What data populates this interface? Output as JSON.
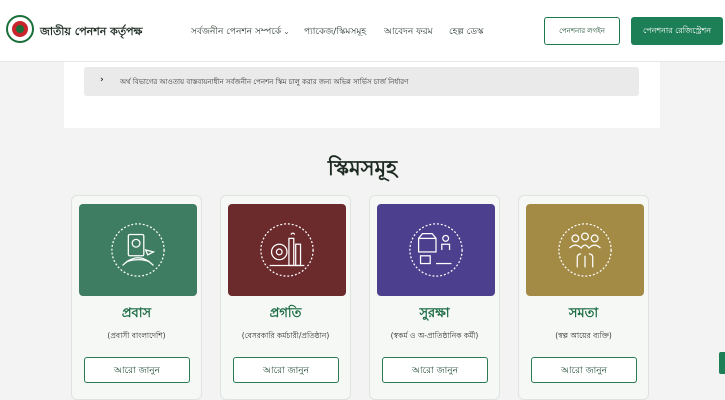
{
  "header": {
    "logo_icon": "government-seal-icon",
    "brand": "জাতীয় পেনশন কর্তৃপক্ষ",
    "nav": [
      {
        "label": "সর্বজনীন পেনশন সম্পর্কে",
        "dropdown": true
      },
      {
        "label": "প্যাকেজ/স্কিমসমূহ",
        "dropdown": false
      },
      {
        "label": "আবেদন ফরম",
        "dropdown": false
      },
      {
        "label": "হেল্প ডেস্ক",
        "dropdown": false
      }
    ],
    "chevron": "⌄",
    "login_label": "পেনশনার লগইন",
    "register_label": "পেনশনার রেজিস্ট্রেশন"
  },
  "notice": {
    "arrow": "›",
    "text": "অর্থ বিভাগের আওতায় বাস্তবায়নাধীন সর্বজনীন পেনশন স্কিম চালু করার জন্য অভিন্ন সার্ভিস চার্জ নির্ধারণ"
  },
  "schemes": {
    "title": "স্কিমসমূহ",
    "cards": [
      {
        "title": "প্রবাস",
        "subtitle": "(প্রবাসী বাংলাদেশি)",
        "button": "আরো জানুন",
        "color": "#3f7d62",
        "icon": "passport-globe-icon"
      },
      {
        "title": "প্রগতি",
        "subtitle": "(বেসরকারি কর্মচারী/প্রতিষ্ঠান)",
        "button": "আরো জানুন",
        "color": "#6b2a2c",
        "icon": "industry-gear-icon"
      },
      {
        "title": "সুরক্ষা",
        "subtitle": "(স্বকর্ম ও অ-প্রাতিষ্ঠানিক কর্মী)",
        "button": "আরো জানুন",
        "color": "#4b3f8e",
        "icon": "self-employed-workers-icon"
      },
      {
        "title": "সমতা",
        "subtitle": "(স্বল্প আয়ের ব্যক্তি)",
        "button": "আরো জানুন",
        "color": "#a38a45",
        "icon": "community-hands-icon"
      }
    ]
  },
  "colors": {
    "brand_green": "#1d7f55",
    "title_green": "#1d6d45"
  }
}
